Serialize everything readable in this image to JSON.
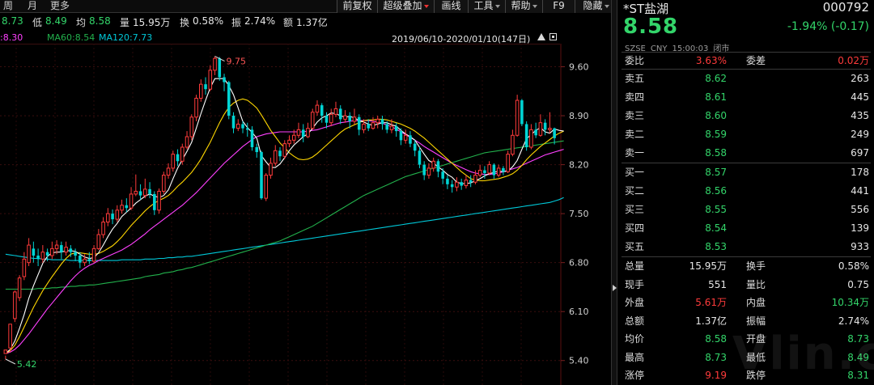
{
  "toolbar": {
    "periods": [
      "周",
      "月",
      "更多"
    ],
    "buttons": [
      {
        "label": "前复权",
        "caret": false
      },
      {
        "label": "超级叠加",
        "caret": true
      },
      {
        "label": "画线",
        "caret": false
      },
      {
        "label": "工具",
        "caret": true
      },
      {
        "label": "帮助",
        "caret": true
      },
      {
        "label": "F9",
        "caret": false
      },
      {
        "label": "隐藏",
        "caret": true
      }
    ]
  },
  "stats": {
    "high_value": "8.73",
    "low_label": "低",
    "low_value": "8.49",
    "avg_label": "均",
    "avg_value": "8.58",
    "vol_label": "量",
    "vol_value": "15.95万",
    "turn_label": "换",
    "turn_value": "0.58%",
    "amp_label": "振",
    "amp_value": "2.74%",
    "amt_label": "额",
    "amt_value": "1.37亿"
  },
  "ma_legend": {
    "ma_first": ":8.30",
    "ma60": "MA60:8.54",
    "ma120": "MA120:7.73"
  },
  "date_range": "2019/06/10-2020/01/10(147日)",
  "colors": {
    "up": "#ff3b3b",
    "down": "#00d4d4",
    "green": "#33d56a",
    "ma5": "#ffffff",
    "ma10": "#ffd700",
    "ma20": "#ff40ff",
    "ma60": "#22b14c",
    "ma120": "#00c8d8"
  },
  "chart_data": {
    "type": "candlestick",
    "y_ticks": [
      9.6,
      8.9,
      8.2,
      7.5,
      6.8,
      6.1,
      5.4
    ],
    "ylim": [
      5.05,
      9.93
    ],
    "annotations": {
      "high_label": "9.75",
      "low_label": "5.42"
    },
    "candles": [
      [
        5.5,
        5.55,
        5.47,
        5.42
      ],
      [
        5.58,
        5.92,
        5.92,
        5.52
      ],
      [
        6.0,
        6.38,
        6.4,
        5.95
      ],
      [
        6.3,
        6.58,
        6.62,
        6.25
      ],
      [
        6.6,
        6.85,
        6.95,
        6.55
      ],
      [
        6.8,
        7.05,
        7.15,
        6.75
      ],
      [
        7.0,
        6.9,
        7.1,
        6.8
      ],
      [
        6.9,
        6.85,
        7.0,
        6.75
      ],
      [
        6.85,
        6.95,
        7.05,
        6.8
      ],
      [
        6.95,
        6.9,
        7.0,
        6.82
      ],
      [
        6.9,
        7.0,
        7.1,
        6.85
      ],
      [
        7.0,
        7.05,
        7.12,
        6.92
      ],
      [
        7.05,
        6.95,
        7.1,
        6.85
      ],
      [
        6.95,
        7.02,
        7.1,
        6.9
      ],
      [
        7.0,
        6.95,
        7.05,
        6.88
      ],
      [
        6.95,
        6.9,
        7.0,
        6.82
      ],
      [
        6.9,
        6.8,
        6.95,
        6.72
      ],
      [
        6.8,
        6.85,
        6.92,
        6.75
      ],
      [
        6.85,
        6.82,
        6.95,
        6.78
      ],
      [
        6.82,
        7.0,
        7.05,
        6.8
      ],
      [
        7.0,
        7.2,
        7.28,
        6.98
      ],
      [
        7.2,
        7.38,
        7.45,
        7.15
      ],
      [
        7.38,
        7.5,
        7.58,
        7.32
      ],
      [
        7.5,
        7.42,
        7.56,
        7.35
      ],
      [
        7.42,
        7.55,
        7.62,
        7.38
      ],
      [
        7.55,
        7.62,
        7.7,
        7.5
      ],
      [
        7.62,
        7.58,
        7.72,
        7.52
      ],
      [
        7.58,
        7.78,
        7.88,
        7.55
      ],
      [
        7.78,
        7.82,
        8.06,
        7.75
      ],
      [
        7.82,
        7.76,
        7.92,
        7.7
      ],
      [
        7.76,
        7.85,
        8.0,
        7.72
      ],
      [
        7.85,
        7.78,
        7.95,
        7.72
      ],
      [
        7.78,
        7.55,
        7.82,
        7.48
      ],
      [
        7.55,
        7.82,
        7.86,
        7.5
      ],
      [
        7.82,
        8.05,
        8.1,
        7.78
      ],
      [
        8.05,
        8.15,
        8.22,
        8.0
      ],
      [
        8.15,
        8.35,
        8.4,
        8.1
      ],
      [
        8.35,
        8.25,
        8.42,
        8.18
      ],
      [
        8.25,
        8.45,
        8.5,
        8.2
      ],
      [
        8.45,
        8.6,
        8.68,
        8.42
      ],
      [
        8.6,
        8.88,
        8.92,
        8.55
      ],
      [
        8.88,
        9.15,
        9.2,
        8.82
      ],
      [
        9.15,
        9.35,
        9.42,
        9.1
      ],
      [
        9.35,
        9.28,
        9.45,
        9.2
      ],
      [
        9.28,
        9.55,
        9.62,
        9.25
      ],
      [
        9.55,
        9.72,
        9.75,
        9.48
      ],
      [
        9.72,
        9.45,
        9.74,
        9.4
      ],
      [
        9.45,
        9.38,
        9.5,
        9.25
      ],
      [
        9.38,
        8.9,
        9.4,
        8.85
      ],
      [
        8.9,
        8.72,
        8.95,
        8.65
      ],
      [
        8.72,
        8.78,
        8.85,
        8.68
      ],
      [
        8.78,
        8.72,
        8.82,
        8.65
      ],
      [
        8.72,
        8.7,
        8.8,
        8.6
      ],
      [
        8.7,
        8.45,
        8.75,
        8.4
      ],
      [
        8.45,
        8.38,
        8.5,
        8.3
      ],
      [
        8.38,
        7.72,
        8.4,
        7.7
      ],
      [
        7.72,
        8.05,
        8.08,
        7.68
      ],
      [
        8.05,
        8.22,
        8.3,
        8.0
      ],
      [
        8.22,
        8.4,
        8.48,
        8.18
      ],
      [
        8.4,
        8.32,
        8.45,
        8.25
      ],
      [
        8.32,
        8.5,
        8.55,
        8.28
      ],
      [
        8.5,
        8.55,
        8.62,
        8.45
      ],
      [
        8.55,
        8.62,
        8.7,
        8.5
      ],
      [
        8.62,
        8.7,
        8.8,
        8.58
      ],
      [
        8.7,
        8.6,
        8.78,
        8.52
      ],
      [
        8.6,
        8.72,
        8.8,
        8.58
      ],
      [
        8.72,
        8.95,
        9.0,
        8.7
      ],
      [
        8.95,
        9.05,
        9.12,
        8.9
      ],
      [
        9.05,
        8.9,
        9.08,
        8.8
      ],
      [
        8.9,
        8.8,
        8.95,
        8.72
      ],
      [
        8.8,
        8.92,
        9.0,
        8.75
      ],
      [
        8.92,
        9.0,
        9.1,
        8.88
      ],
      [
        9.0,
        8.85,
        9.05,
        8.78
      ],
      [
        8.85,
        8.9,
        8.98,
        8.8
      ],
      [
        8.9,
        8.82,
        8.95,
        8.72
      ],
      [
        8.82,
        8.88,
        9.0,
        8.78
      ],
      [
        8.88,
        8.7,
        8.92,
        8.62
      ],
      [
        8.7,
        8.78,
        8.85,
        8.65
      ],
      [
        8.78,
        8.72,
        8.85,
        8.68
      ],
      [
        8.72,
        8.8,
        8.88,
        8.7
      ],
      [
        8.8,
        8.85,
        8.9,
        8.72
      ],
      [
        8.85,
        8.78,
        8.9,
        8.7
      ],
      [
        8.78,
        8.7,
        8.82,
        8.65
      ],
      [
        8.7,
        8.75,
        8.85,
        8.65
      ],
      [
        8.75,
        8.68,
        8.8,
        8.6
      ],
      [
        8.68,
        8.55,
        8.72,
        8.48
      ],
      [
        8.55,
        8.62,
        8.7,
        8.5
      ],
      [
        8.62,
        8.5,
        8.68,
        8.45
      ],
      [
        8.5,
        8.4,
        8.55,
        8.32
      ],
      [
        8.4,
        8.2,
        8.45,
        8.15
      ],
      [
        8.2,
        8.05,
        8.25,
        7.98
      ],
      [
        8.05,
        8.15,
        8.22,
        8.0
      ],
      [
        8.15,
        8.25,
        8.3,
        8.1
      ],
      [
        8.25,
        8.1,
        8.28,
        8.02
      ],
      [
        8.1,
        8.0,
        8.15,
        7.92
      ],
      [
        8.0,
        7.92,
        8.05,
        7.85
      ],
      [
        7.92,
        7.88,
        7.98,
        7.8
      ],
      [
        7.88,
        7.95,
        8.02,
        7.82
      ],
      [
        7.95,
        7.9,
        8.0,
        7.84
      ],
      [
        7.9,
        7.98,
        8.05,
        7.86
      ],
      [
        7.98,
        7.95,
        8.05,
        7.88
      ],
      [
        7.95,
        8.05,
        8.12,
        7.92
      ],
      [
        8.05,
        8.12,
        8.2,
        8.02
      ],
      [
        8.12,
        8.08,
        8.18,
        8.0
      ],
      [
        8.08,
        8.2,
        8.25,
        8.05
      ],
      [
        8.2,
        8.05,
        8.22,
        8.0
      ],
      [
        8.05,
        8.15,
        8.2,
        8.02
      ],
      [
        8.15,
        8.1,
        8.18,
        8.05
      ],
      [
        8.1,
        8.35,
        8.4,
        8.08
      ],
      [
        8.35,
        8.62,
        8.7,
        8.32
      ],
      [
        8.62,
        9.12,
        9.2,
        8.6
      ],
      [
        9.12,
        8.78,
        9.14,
        8.75
      ],
      [
        8.78,
        8.45,
        8.82,
        8.4
      ],
      [
        8.45,
        8.7,
        8.78,
        8.42
      ],
      [
        8.7,
        8.62,
        8.8,
        8.58
      ],
      [
        8.62,
        8.8,
        8.92,
        8.6
      ],
      [
        8.8,
        8.7,
        8.85,
        8.62
      ],
      [
        8.7,
        8.72,
        8.95,
        8.65
      ],
      [
        8.72,
        8.58,
        8.73,
        8.49
      ]
    ],
    "ma5": [
      5.5,
      5.56,
      5.68,
      5.86,
      6.06,
      6.29,
      6.47,
      6.63,
      6.79,
      6.89,
      6.94,
      6.95,
      6.95,
      6.97,
      6.97,
      6.96,
      6.92,
      6.88,
      6.86,
      6.87,
      6.94,
      7.05,
      7.17,
      7.28,
      7.36,
      7.46,
      7.52,
      7.58,
      7.65,
      7.7,
      7.75,
      7.78,
      7.75,
      7.73,
      7.76,
      7.84,
      8.0,
      8.15,
      8.27,
      8.39,
      8.52,
      8.72,
      8.93,
      9.12,
      9.3,
      9.43,
      9.43,
      9.43,
      9.33,
      9.2,
      9.01,
      8.82,
      8.73,
      8.66,
      8.58,
      8.33,
      8.24,
      8.16,
      8.16,
      8.21,
      8.3,
      8.4,
      8.48,
      8.54,
      8.6,
      8.64,
      8.72,
      8.81,
      8.87,
      8.9,
      8.94,
      8.93,
      8.9,
      8.88,
      8.89,
      8.87,
      8.83,
      8.81,
      8.78,
      8.76,
      8.78,
      8.8,
      8.8,
      8.77,
      8.75,
      8.69,
      8.64,
      8.6,
      8.55,
      8.45,
      8.35,
      8.26,
      8.22,
      8.17,
      8.12,
      8.06,
      8.02,
      7.95,
      7.93,
      7.93,
      7.94,
      7.97,
      8.0,
      8.04,
      8.07,
      8.09,
      8.11,
      8.1,
      8.11,
      8.17,
      8.26,
      8.42,
      8.57,
      8.63,
      8.69,
      8.73,
      8.67,
      8.65,
      8.71,
      8.69,
      8.68
    ],
    "ma10": [
      5.5,
      5.54,
      5.62,
      5.74,
      5.88,
      6.02,
      6.16,
      6.28,
      6.4,
      6.5,
      6.6,
      6.69,
      6.78,
      6.86,
      6.92,
      6.94,
      6.94,
      6.93,
      6.92,
      6.92,
      6.93,
      6.96,
      7.0,
      7.04,
      7.1,
      7.17,
      7.25,
      7.33,
      7.4,
      7.47,
      7.54,
      7.6,
      7.65,
      7.69,
      7.72,
      7.76,
      7.82,
      7.89,
      7.95,
      8.02,
      8.09,
      8.18,
      8.28,
      8.4,
      8.52,
      8.66,
      8.8,
      8.92,
      9.02,
      9.08,
      9.12,
      9.14,
      9.12,
      9.07,
      9.01,
      8.91,
      8.8,
      8.69,
      8.6,
      8.51,
      8.44,
      8.37,
      8.32,
      8.28,
      8.27,
      8.28,
      8.31,
      8.36,
      8.42,
      8.48,
      8.54,
      8.6,
      8.66,
      8.71,
      8.74,
      8.77,
      8.8,
      8.83,
      8.84,
      8.84,
      8.85,
      8.85,
      8.84,
      8.82,
      8.8,
      8.78,
      8.75,
      8.72,
      8.68,
      8.63,
      8.58,
      8.52,
      8.46,
      8.4,
      8.34,
      8.28,
      8.22,
      8.16,
      8.1,
      8.05,
      8.0,
      7.98,
      7.97,
      7.97,
      7.98,
      7.99,
      8.0,
      8.02,
      8.04,
      8.07,
      8.12,
      8.19,
      8.27,
      8.34,
      8.4,
      8.46,
      8.51,
      8.56,
      8.61,
      8.65,
      8.68
    ],
    "ma20": [
      5.5,
      5.52,
      5.56,
      5.62,
      5.7,
      5.78,
      5.87,
      5.96,
      6.05,
      6.14,
      6.22,
      6.3,
      6.38,
      6.46,
      6.54,
      6.61,
      6.67,
      6.72,
      6.76,
      6.79,
      6.83,
      6.86,
      6.89,
      6.92,
      6.95,
      6.98,
      7.02,
      7.06,
      7.11,
      7.16,
      7.21,
      7.27,
      7.32,
      7.37,
      7.42,
      7.47,
      7.52,
      7.57,
      7.62,
      7.68,
      7.74,
      7.8,
      7.87,
      7.94,
      8.01,
      8.08,
      8.15,
      8.22,
      8.28,
      8.34,
      8.4,
      8.46,
      8.51,
      8.56,
      8.6,
      8.62,
      8.64,
      8.65,
      8.66,
      8.67,
      8.67,
      8.67,
      8.67,
      8.67,
      8.67,
      8.68,
      8.69,
      8.7,
      8.72,
      8.74,
      8.76,
      8.78,
      8.8,
      8.81,
      8.82,
      8.83,
      8.83,
      8.83,
      8.83,
      8.82,
      8.81,
      8.79,
      8.77,
      8.74,
      8.71,
      8.67,
      8.63,
      8.59,
      8.55,
      8.51,
      8.46,
      8.42,
      8.38,
      8.34,
      8.3,
      8.26,
      8.22,
      8.19,
      8.16,
      8.13,
      8.1,
      8.08,
      8.07,
      8.06,
      8.06,
      8.07,
      8.08,
      8.1,
      8.12,
      8.14,
      8.16,
      8.19,
      8.22,
      8.25,
      8.28,
      8.31,
      8.34,
      8.36,
      8.38,
      8.4,
      8.42
    ],
    "ma60": [
      6.42,
      6.42,
      6.42,
      6.42,
      6.42,
      6.42,
      6.42,
      6.43,
      6.43,
      6.43,
      6.44,
      6.44,
      6.45,
      6.45,
      6.46,
      6.46,
      6.47,
      6.47,
      6.48,
      6.48,
      6.49,
      6.5,
      6.51,
      6.52,
      6.53,
      6.54,
      6.55,
      6.56,
      6.57,
      6.58,
      6.6,
      6.61,
      6.62,
      6.63,
      6.65,
      6.66,
      6.67,
      6.69,
      6.7,
      6.72,
      6.73,
      6.75,
      6.77,
      6.79,
      6.81,
      6.83,
      6.85,
      6.87,
      6.89,
      6.91,
      6.93,
      6.95,
      6.97,
      6.99,
      7.01,
      7.03,
      7.05,
      7.07,
      7.09,
      7.11,
      7.14,
      7.17,
      7.2,
      7.23,
      7.26,
      7.29,
      7.32,
      7.36,
      7.4,
      7.44,
      7.48,
      7.52,
      7.56,
      7.6,
      7.64,
      7.68,
      7.72,
      7.76,
      7.79,
      7.82,
      7.85,
      7.88,
      7.91,
      7.94,
      7.97,
      8.0,
      8.03,
      8.05,
      8.07,
      8.09,
      8.11,
      8.13,
      8.15,
      8.17,
      8.19,
      8.21,
      8.23,
      8.25,
      8.27,
      8.29,
      8.31,
      8.33,
      8.35,
      8.37,
      8.38,
      8.39,
      8.4,
      8.41,
      8.42,
      8.43,
      8.44,
      8.45,
      8.46,
      8.47,
      8.48,
      8.49,
      8.5,
      8.51,
      8.52,
      8.53,
      8.54
    ],
    "ma120": [
      6.92,
      6.91,
      6.9,
      6.89,
      6.88,
      6.87,
      6.86,
      6.86,
      6.85,
      6.85,
      6.84,
      6.84,
      6.84,
      6.84,
      6.83,
      6.83,
      6.83,
      6.83,
      6.83,
      6.83,
      6.83,
      6.83,
      6.83,
      6.83,
      6.83,
      6.84,
      6.84,
      6.84,
      6.84,
      6.84,
      6.85,
      6.85,
      6.85,
      6.86,
      6.86,
      6.87,
      6.87,
      6.88,
      6.88,
      6.89,
      6.89,
      6.9,
      6.91,
      6.92,
      6.93,
      6.94,
      6.95,
      6.96,
      6.97,
      6.98,
      6.99,
      7.0,
      7.01,
      7.02,
      7.03,
      7.04,
      7.05,
      7.06,
      7.07,
      7.08,
      7.09,
      7.1,
      7.11,
      7.12,
      7.13,
      7.14,
      7.15,
      7.16,
      7.17,
      7.18,
      7.19,
      7.2,
      7.21,
      7.22,
      7.23,
      7.24,
      7.25,
      7.26,
      7.27,
      7.28,
      7.29,
      7.3,
      7.31,
      7.32,
      7.33,
      7.34,
      7.35,
      7.36,
      7.37,
      7.38,
      7.39,
      7.4,
      7.41,
      7.42,
      7.43,
      7.44,
      7.45,
      7.46,
      7.47,
      7.48,
      7.49,
      7.5,
      7.51,
      7.52,
      7.53,
      7.54,
      7.55,
      7.56,
      7.57,
      7.58,
      7.59,
      7.6,
      7.61,
      7.62,
      7.63,
      7.64,
      7.65,
      7.66,
      7.68,
      7.7,
      7.73
    ]
  },
  "quote": {
    "name": "*ST盐湖",
    "code": "000792",
    "price": "8.58",
    "change": "-1.94% (-0.17)",
    "exchange": "SZSE",
    "currency": "CNY",
    "time": "15:00:03",
    "status": "闭市",
    "weibi_label": "委比",
    "weibi_value": "3.63%",
    "weicha_label": "委差",
    "weicha_value": "0.02万",
    "asks": [
      {
        "label": "卖五",
        "price": "8.62",
        "volume": "263"
      },
      {
        "label": "卖四",
        "price": "8.61",
        "volume": "445"
      },
      {
        "label": "卖三",
        "price": "8.60",
        "volume": "435"
      },
      {
        "label": "卖二",
        "price": "8.59",
        "volume": "249"
      },
      {
        "label": "卖一",
        "price": "8.58",
        "volume": "697"
      }
    ],
    "bids": [
      {
        "label": "买一",
        "price": "8.57",
        "volume": "178"
      },
      {
        "label": "买二",
        "price": "8.56",
        "volume": "441"
      },
      {
        "label": "买三",
        "price": "8.55",
        "volume": "556"
      },
      {
        "label": "买四",
        "price": "8.54",
        "volume": "139"
      },
      {
        "label": "买五",
        "price": "8.53",
        "volume": "933"
      }
    ],
    "stats": [
      {
        "l1": "总量",
        "v1": "15.95万",
        "c1": "#e6e6e6",
        "l2": "换手",
        "v2": "0.58%",
        "c2": "#e6e6e6"
      },
      {
        "l1": "现手",
        "v1": "551",
        "c1": "#e6e6e6",
        "l2": "量比",
        "v2": "0.75",
        "c2": "#e6e6e6"
      },
      {
        "l1": "外盘",
        "v1": "5.61万",
        "c1": "#ff3b3b",
        "l2": "内盘",
        "v2": "10.34万",
        "c2": "#33d56a"
      },
      {
        "l1": "总额",
        "v1": "1.37亿",
        "c1": "#e6e6e6",
        "l2": "振幅",
        "v2": "2.74%",
        "c2": "#e6e6e6"
      },
      {
        "l1": "均价",
        "v1": "8.58",
        "c1": "#33d56a",
        "l2": "开盘",
        "v2": "8.73",
        "c2": "#33d56a"
      },
      {
        "l1": "最高",
        "v1": "8.73",
        "c1": "#33d56a",
        "l2": "最低",
        "v2": "8.49",
        "c2": "#33d56a"
      },
      {
        "l1": "涨停",
        "v1": "9.19",
        "c1": "#ff3b3b",
        "l2": "跌停",
        "v2": "8.31",
        "c2": "#33d56a"
      }
    ]
  },
  "watermark": "Vlin.c"
}
